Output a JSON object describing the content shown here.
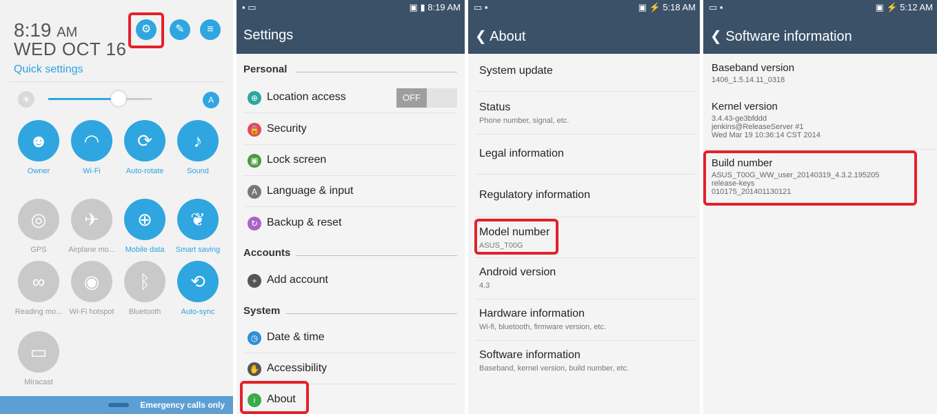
{
  "quick_panel": {
    "time": "8:19",
    "ampm": "AM",
    "date": "WED OCT 16",
    "quick_settings_label": "Quick settings",
    "settings_icon": "gear-icon",
    "edit_icon": "edit-icon",
    "notes_icon": "notes-icon",
    "brightness_level_fraction": 0.68,
    "tiles": [
      {
        "label": "Owner",
        "icon": "person-icon",
        "on": true
      },
      {
        "label": "Wi-Fi",
        "icon": "wifi-icon",
        "on": true
      },
      {
        "label": "Auto-rotate",
        "icon": "rotate-icon",
        "on": true
      },
      {
        "label": "Sound",
        "icon": "sound-icon",
        "on": true
      },
      {
        "label": "GPS",
        "icon": "gps-icon",
        "on": false
      },
      {
        "label": "Airplane mo...",
        "icon": "airplane-icon",
        "on": false
      },
      {
        "label": "Mobile data",
        "icon": "globe-icon",
        "on": true
      },
      {
        "label": "Smart saving",
        "icon": "leaf-icon",
        "on": true
      },
      {
        "label": "Reading mo...",
        "icon": "glasses-icon",
        "on": false
      },
      {
        "label": "Wi-Fi hotspot",
        "icon": "hotspot-icon",
        "on": false
      },
      {
        "label": "Bluetooth",
        "icon": "bluetooth-icon",
        "on": false
      },
      {
        "label": "Auto-sync",
        "icon": "sync-icon",
        "on": true
      },
      {
        "label": "Miracast",
        "icon": "cast-icon",
        "on": false
      }
    ],
    "emergency": "Emergency calls only"
  },
  "settings": {
    "status_time": "8:19 AM",
    "title": "Settings",
    "sections": {
      "personal": "Personal",
      "accounts": "Accounts",
      "system": "System"
    },
    "items": {
      "location": "Location access",
      "location_toggle": "OFF",
      "security": "Security",
      "lock": "Lock screen",
      "language": "Language & input",
      "backup": "Backup & reset",
      "add_account": "Add account",
      "date_time": "Date & time",
      "accessibility": "Accessibility",
      "about": "About"
    }
  },
  "about": {
    "status_time": "5:18 AM",
    "title": "About",
    "items": [
      {
        "title": "System update",
        "sub": ""
      },
      {
        "title": "Status",
        "sub": "Phone number, signal, etc."
      },
      {
        "title": "Legal information",
        "sub": ""
      },
      {
        "title": "Regulatory information",
        "sub": ""
      },
      {
        "title": "Model number",
        "sub": "ASUS_T00G"
      },
      {
        "title": "Android version",
        "sub": "4.3"
      },
      {
        "title": "Hardware information",
        "sub": "Wi-fi, bluetooth, firmware version, etc."
      },
      {
        "title": "Software information",
        "sub": "Baseband, kernel version, build number, etc."
      }
    ]
  },
  "software": {
    "status_time": "5:12 AM",
    "title": "Software information",
    "baseband_title": "Baseband version",
    "baseband_value": "1406_1.5.14.11_0318",
    "kernel_title": "Kernel version",
    "kernel_line1": "3.4.43-ge3bfddd",
    "kernel_line2": "jenkins@ReleaseServer #1",
    "kernel_line3": "Wed Mar 19 10:36:14 CST 2014",
    "build_title": "Build number",
    "build_line1": "ASUS_T00G_WW_user_20140319_4.3.2.195205",
    "build_line2": "release-keys",
    "build_line3": "010175_201401130121"
  }
}
